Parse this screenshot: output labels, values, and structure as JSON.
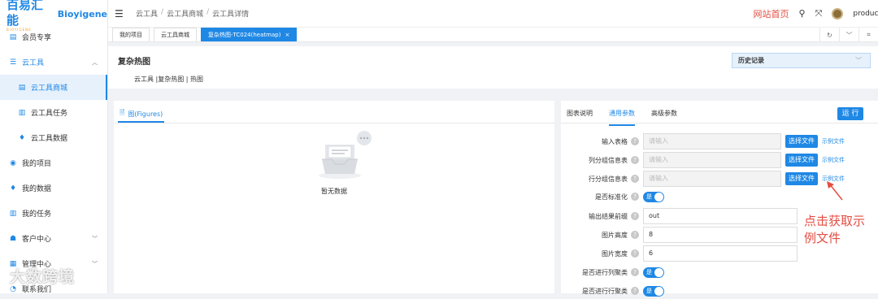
{
  "logo": {
    "cn": "百易汇能",
    "sub": "BIOYIGENE",
    "en": "Bioyigene"
  },
  "sidebar": {
    "items": [
      {
        "label": "会员专享"
      },
      {
        "label": "云工具"
      },
      {
        "label": "云工具商城"
      },
      {
        "label": "云工具任务"
      },
      {
        "label": "云工具数据"
      },
      {
        "label": "我的项目"
      },
      {
        "label": "我的数据"
      },
      {
        "label": "我的任务"
      },
      {
        "label": "客户中心"
      },
      {
        "label": "管理中心"
      },
      {
        "label": "联系我们"
      }
    ]
  },
  "breadcrumb": [
    "云工具",
    "云工具商城",
    "云工具详情"
  ],
  "header": {
    "home_link": "网站首页",
    "user": "product"
  },
  "tabs": [
    {
      "label": "我的项目"
    },
    {
      "label": "云工具商城"
    },
    {
      "label": "复杂热图-TC024(heatmap)"
    }
  ],
  "page": {
    "title": "复杂热图",
    "subtitle": "云工具 |复杂热图 | 热图",
    "history_label": "历史记录"
  },
  "figures": {
    "tab_label": "图(Figures)",
    "empty_text": "暂无数据"
  },
  "params": {
    "tabs": [
      "图表说明",
      "通用参数",
      "高级参数"
    ],
    "run_label": "运 行",
    "choose_label": "选择文件",
    "example_label": "示例文件",
    "placeholder": "请输入",
    "switch_on": "是",
    "fields": [
      {
        "label": "输入表格"
      },
      {
        "label": "列分组信息表"
      },
      {
        "label": "行分组信息表"
      },
      {
        "label": "是否标准化"
      },
      {
        "label": "输出结果前缀",
        "value": "out"
      },
      {
        "label": "图片高度",
        "value": "8"
      },
      {
        "label": "图片宽度",
        "value": "6"
      },
      {
        "label": "是否进行列聚类"
      },
      {
        "label": "是否进行行聚类"
      }
    ]
  },
  "annotation": {
    "text": "点击获取示例文件"
  },
  "watermark": {
    "text": "大数跨境"
  }
}
